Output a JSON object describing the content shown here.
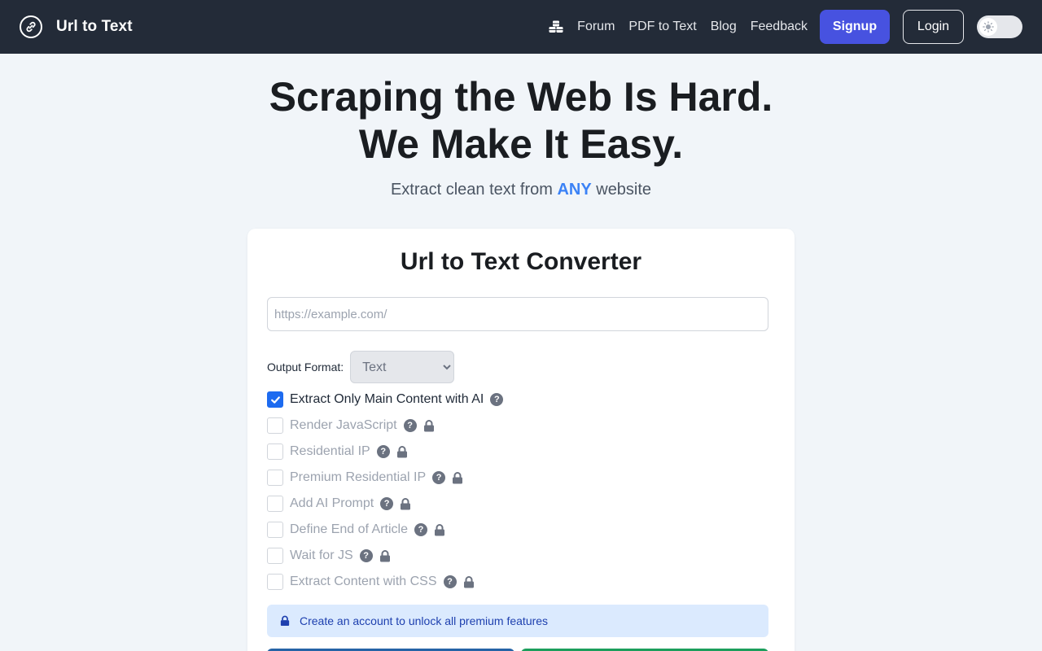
{
  "nav": {
    "brand": "Url to Text",
    "links": [
      "Forum",
      "PDF to Text",
      "Blog",
      "Feedback"
    ],
    "signup": "Signup",
    "login": "Login"
  },
  "hero": {
    "title_line1": "Scraping the Web Is Hard.",
    "title_line2": "We Make It Easy.",
    "subtitle_pre": "Extract clean text from ",
    "subtitle_accent": "ANY",
    "subtitle_post": " website"
  },
  "converter": {
    "title": "Url to Text Converter",
    "url_placeholder": "https://example.com/",
    "format_label": "Output Format:",
    "format_selected": "Text",
    "options": [
      {
        "label": "Extract Only Main Content with AI",
        "checked": true,
        "locked": false
      },
      {
        "label": "Render JavaScript",
        "checked": false,
        "locked": true
      },
      {
        "label": "Residential IP",
        "checked": false,
        "locked": true
      },
      {
        "label": "Premium Residential IP",
        "checked": false,
        "locked": true
      },
      {
        "label": "Add AI Prompt",
        "checked": false,
        "locked": true
      },
      {
        "label": "Define End of Article",
        "checked": false,
        "locked": true
      },
      {
        "label": "Wait for JS",
        "checked": false,
        "locked": true
      },
      {
        "label": "Extract Content with CSS",
        "checked": false,
        "locked": true
      }
    ],
    "notice": "Create an account to unlock all premium features"
  },
  "colors": {
    "navbar_bg": "#232b38",
    "signup_bg": "#4752e0",
    "accent": "#3b82f6",
    "checkbox_checked": "#1d6bf0",
    "notice_bg": "#dbeafe"
  }
}
